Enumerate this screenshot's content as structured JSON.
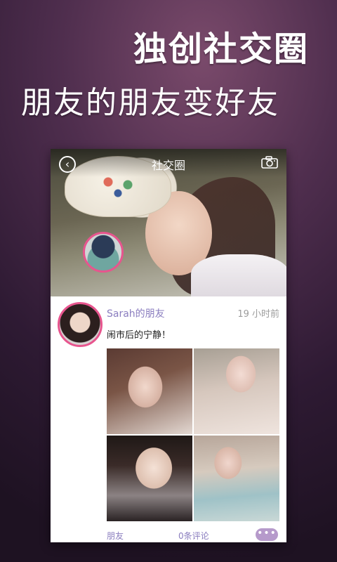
{
  "promo": {
    "headline": "独创社交圈",
    "subline": "朋友的朋友变好友"
  },
  "topbar": {
    "title": "社交圈",
    "back_icon": "back-circle-icon",
    "camera_icon": "camera-icon"
  },
  "post": {
    "author": "Sarah的朋友",
    "time": "19 小时前",
    "content": "闹市后的宁静！",
    "photo_count": 4,
    "footer": {
      "friend_label": "朋友",
      "comments_label": "0条评论",
      "more_label": "•••"
    }
  },
  "colors": {
    "accent_pink": "#e7558e",
    "accent_purple": "#8a7dbf",
    "more_bg": "#b69acb"
  }
}
